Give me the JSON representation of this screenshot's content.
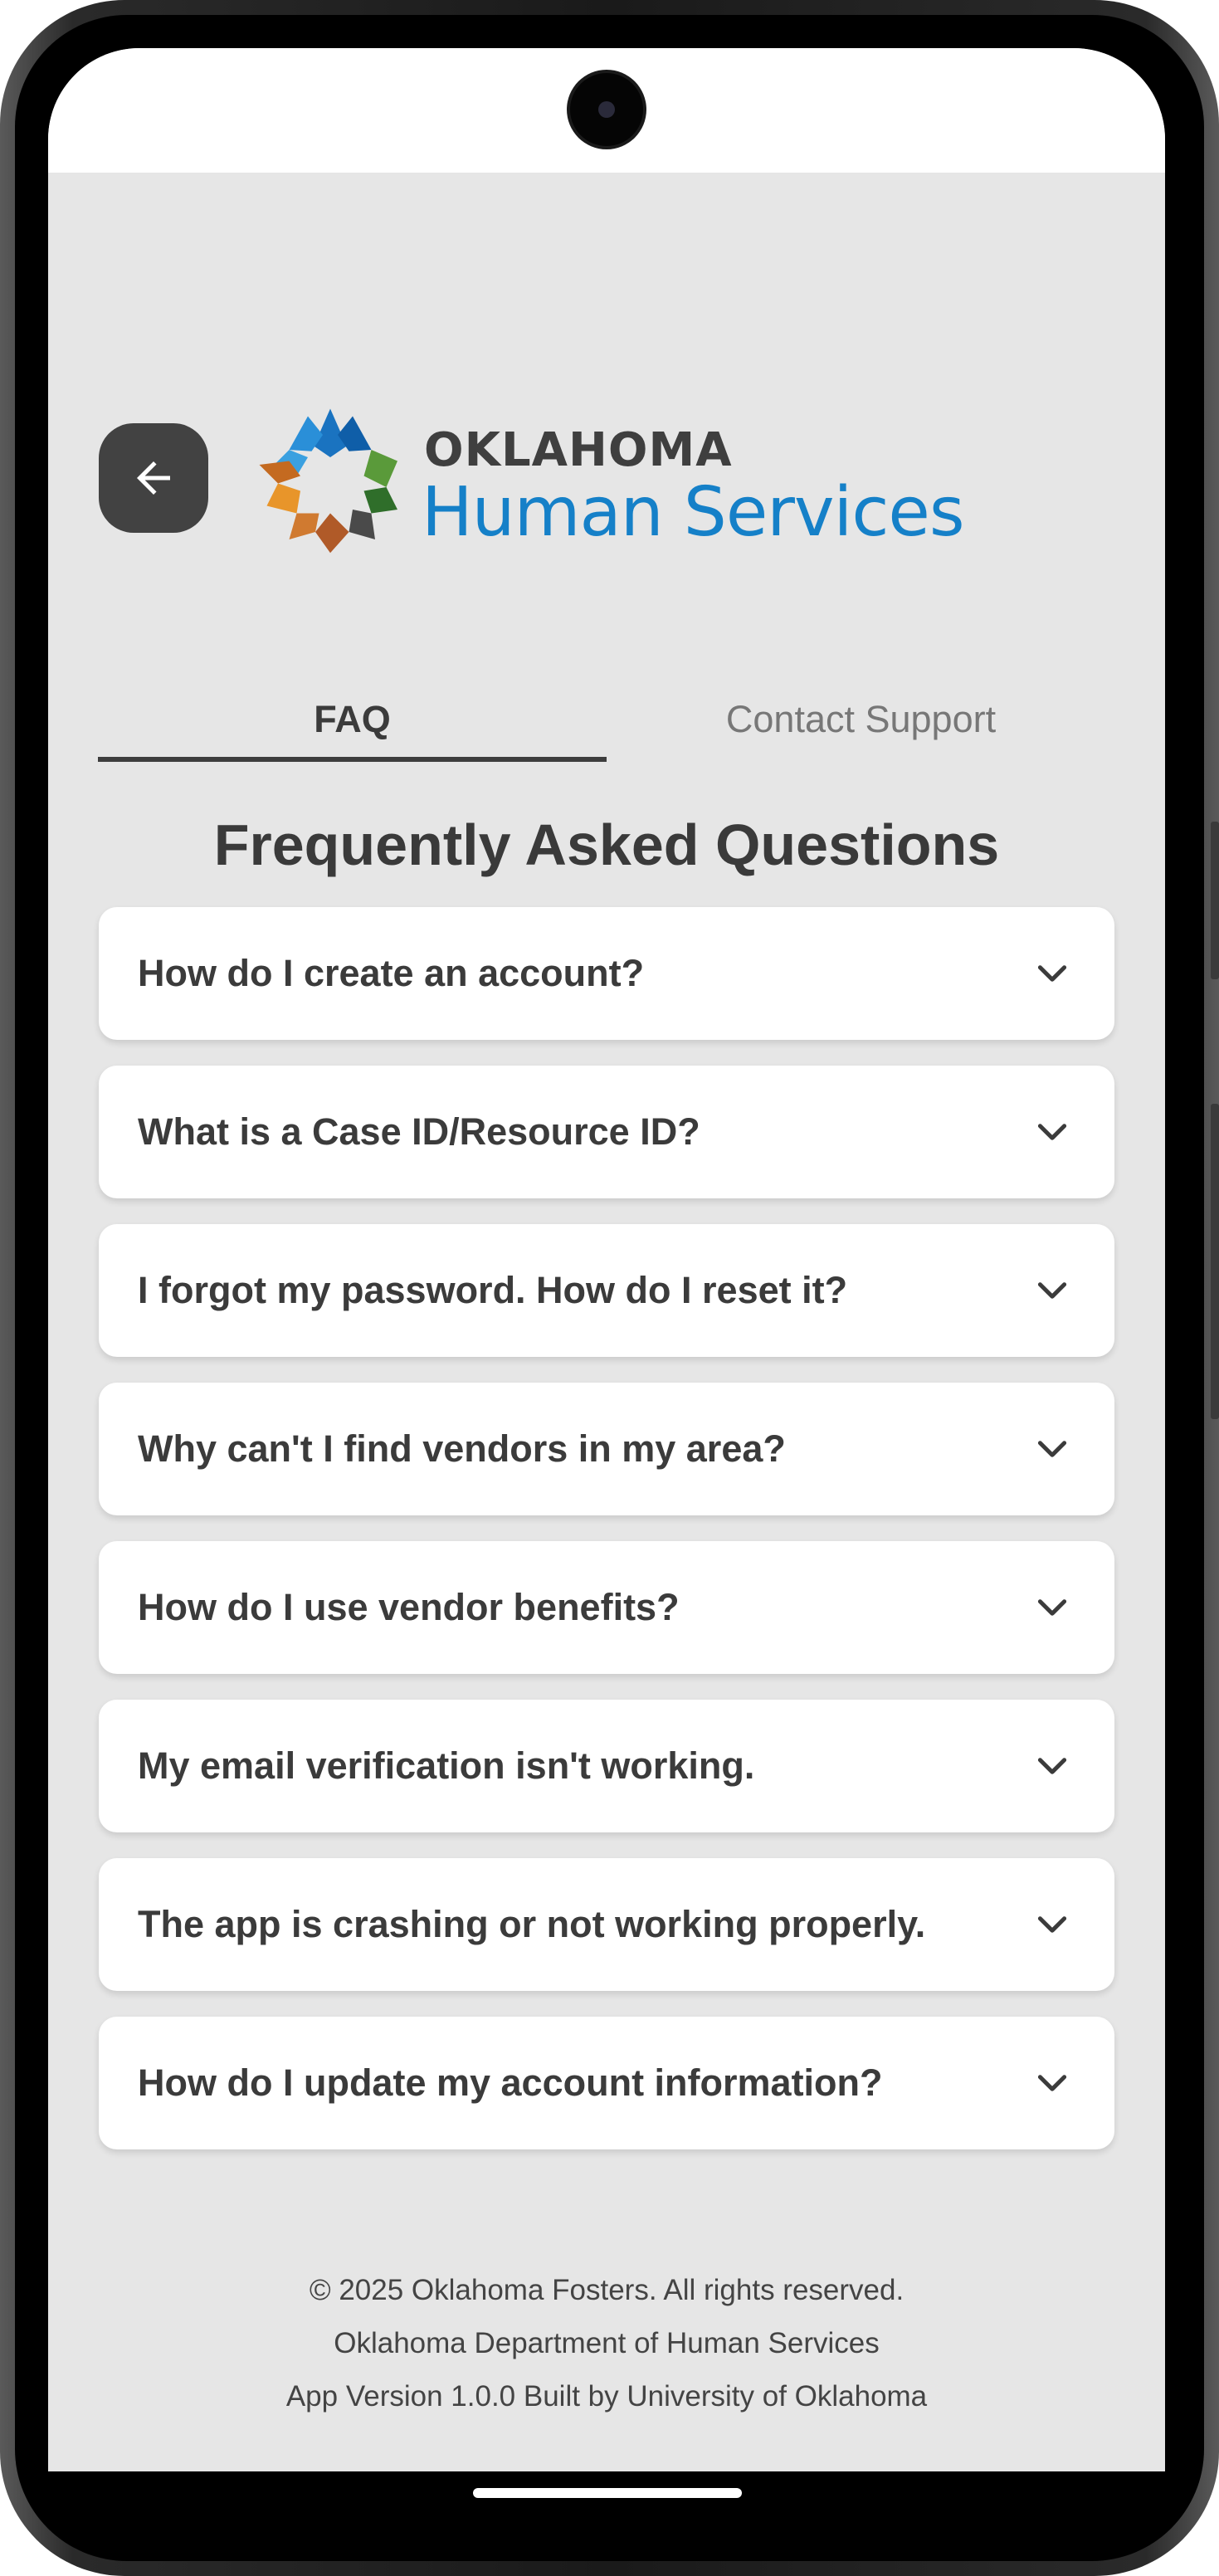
{
  "header": {
    "back_icon": "arrow-left-icon",
    "logo": {
      "line1": "OKLAHOMA",
      "line2": "Human Services",
      "mark_icon": "oklahoma-star-logo-icon"
    }
  },
  "tabs": [
    {
      "label": "FAQ",
      "active": true
    },
    {
      "label": "Contact Support",
      "active": false
    }
  ],
  "faq": {
    "title": "Frequently Asked Questions",
    "chevron_icon": "chevron-down-icon",
    "items": [
      {
        "question": "How do I create an account?"
      },
      {
        "question": "What is a Case ID/Resource ID?"
      },
      {
        "question": "I forgot my password. How do I reset it?"
      },
      {
        "question": "Why can't I find vendors in my area?"
      },
      {
        "question": "How do I use vendor benefits?"
      },
      {
        "question": "My email verification isn't working."
      },
      {
        "question": "The app is crashing or not working properly."
      },
      {
        "question": "How do I update my account information?"
      }
    ]
  },
  "footer": {
    "copyright": "© 2025 Oklahoma Fosters. All rights reserved.",
    "department": "Oklahoma Department of Human Services",
    "version": "App Version 1.0.0 Built by University of Oklahoma"
  },
  "colors": {
    "background": "#e6e6e6",
    "card": "#ffffff",
    "text": "#3b3b3b",
    "brand_blue": "#1580c8",
    "back_button": "#424242"
  }
}
